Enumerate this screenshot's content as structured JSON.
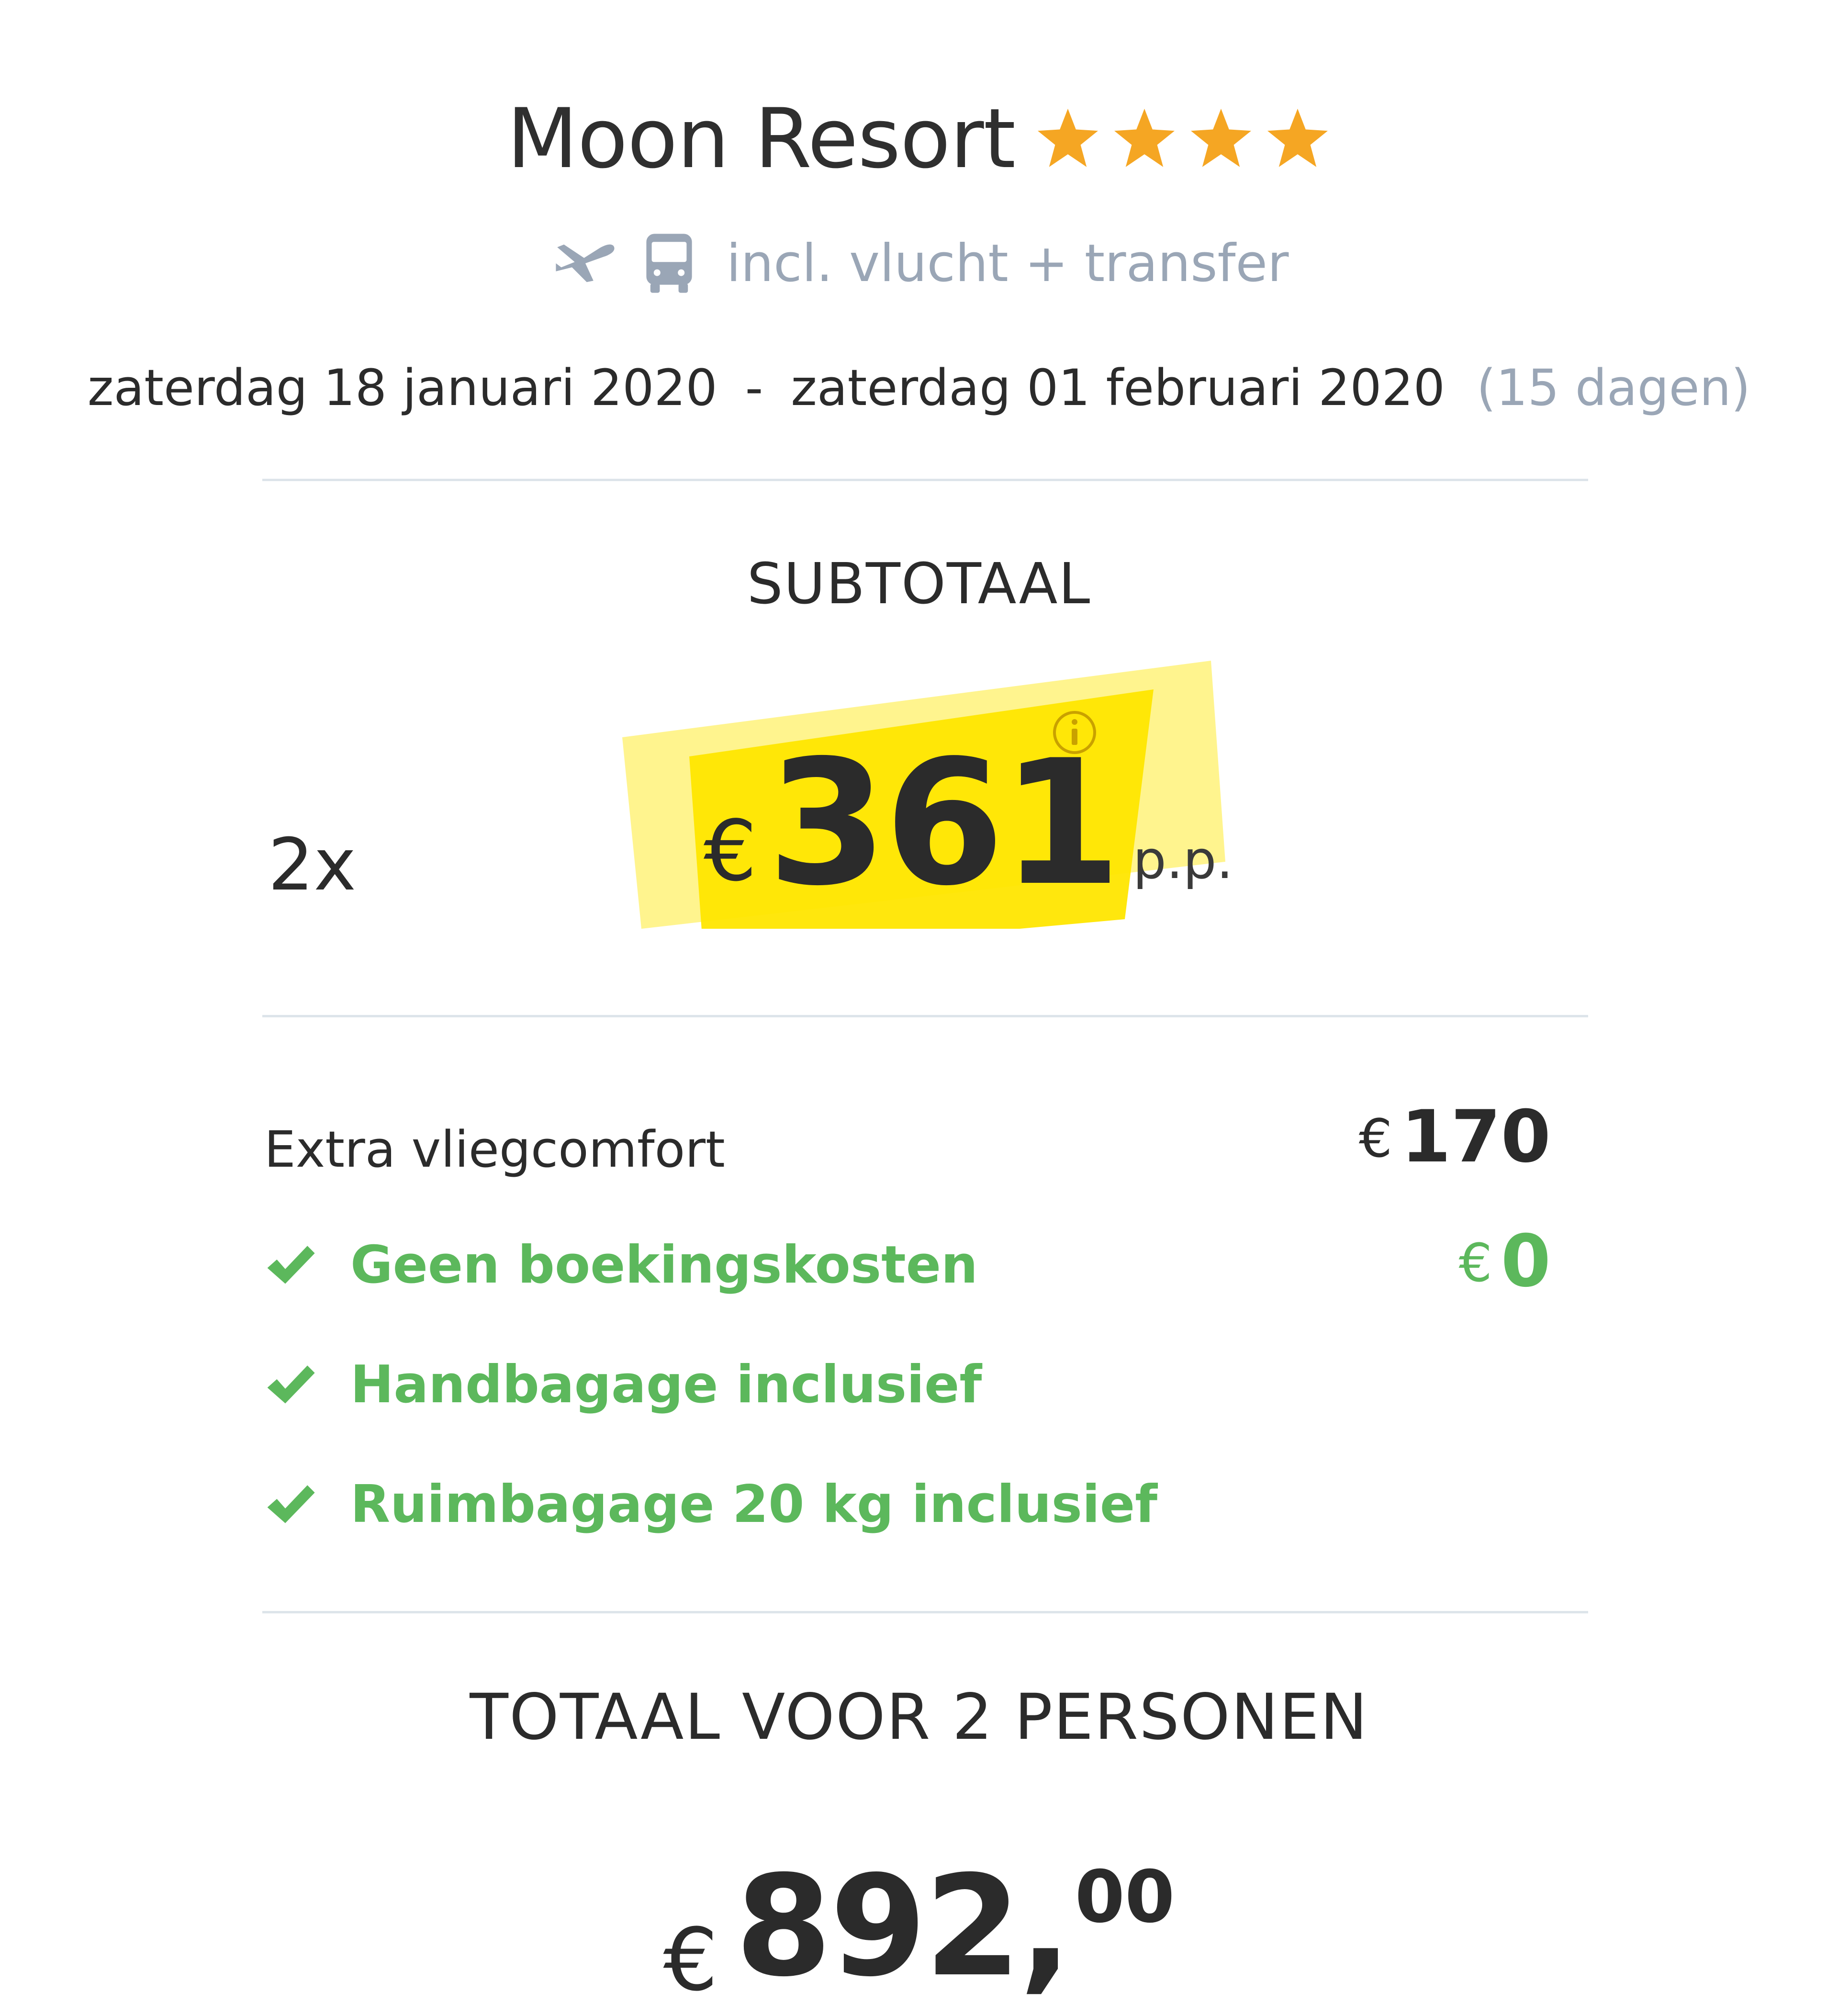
{
  "hotel": {
    "name": "Moon Resort",
    "stars": 4,
    "star_color": "#f5a623",
    "includes_text": "incl. vlucht + transfer",
    "include_icons": [
      "plane-icon",
      "bus-icon"
    ]
  },
  "dates": {
    "start": "zaterdag 18 januari 2020",
    "separator": "-",
    "end": "zaterdag 01 februari 2020",
    "duration": "(15 dagen)"
  },
  "subtotal": {
    "label": "SUBTOTAAL",
    "count": "2x",
    "currency": "€",
    "price": "361",
    "suffix": "p.p.",
    "highlight_color": "#ffe600",
    "info_icon": "info-icon"
  },
  "extras": {
    "flight_comfort": {
      "label": "Extra vliegcomfort",
      "currency": "€",
      "amount": "170"
    },
    "booking_fee": {
      "label": "Geen boekingskosten",
      "currency": "€",
      "amount": "0"
    },
    "hand_luggage": {
      "label": "Handbagage inclusief"
    },
    "hold_luggage": {
      "label": "Ruimbagage 20 kg inclusief"
    },
    "accent_color": "#5cb85c"
  },
  "total": {
    "label": "TOTAAL VOOR 2 PERSONEN",
    "currency": "€",
    "integer": "892,",
    "decimals": "00"
  }
}
